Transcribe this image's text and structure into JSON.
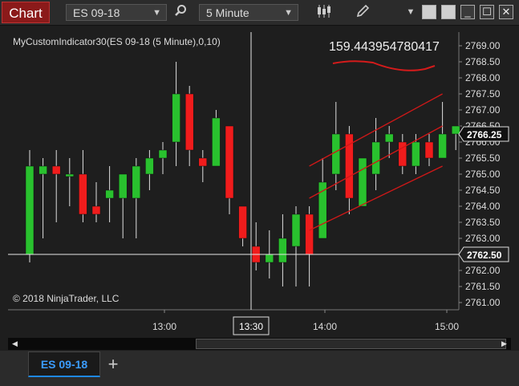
{
  "toolbar": {
    "title": "Chart",
    "instrument": "ES 09-18",
    "interval": "5 Minute"
  },
  "chart": {
    "indicator_label": "MyCustomIndicator30(ES 09-18 (5 Minute),0,10)",
    "big_value": "159.443954780417",
    "copyright": "© 2018 NinjaTrader, LLC",
    "current_price": "2766.25",
    "crosshair_price": "2762.50",
    "crosshair_time": "13:30",
    "colors": {
      "up": "#29c12e",
      "down": "#f01c1c",
      "channel": "#d01818"
    }
  },
  "chart_data": {
    "type": "candlestick",
    "ylim": [
      2760.75,
      2769.25
    ],
    "y_ticks": [
      "2769.00",
      "2768.50",
      "2768.00",
      "2767.50",
      "2767.00",
      "2766.50",
      "2766.00",
      "2765.50",
      "2765.00",
      "2764.50",
      "2764.00",
      "2763.50",
      "2763.00",
      "2762.50",
      "2762.00",
      "2761.50",
      "2761.00"
    ],
    "x_ticks": [
      "13:00",
      "14:00",
      "15:00"
    ],
    "candles": [
      {
        "o": 2762.5,
        "h": 2765.75,
        "l": 2762.25,
        "c": 2765.25
      },
      {
        "o": 2765.0,
        "h": 2765.5,
        "l": 2763.0,
        "c": 2765.25
      },
      {
        "o": 2765.25,
        "h": 2765.75,
        "l": 2763.5,
        "c": 2765.0
      },
      {
        "o": 2765.0,
        "h": 2765.5,
        "l": 2764.0,
        "c": 2765.0
      },
      {
        "o": 2765.0,
        "h": 2765.75,
        "l": 2763.5,
        "c": 2763.75
      },
      {
        "o": 2764.0,
        "h": 2764.75,
        "l": 2763.5,
        "c": 2763.75
      },
      {
        "o": 2764.25,
        "h": 2765.25,
        "l": 2763.5,
        "c": 2764.5
      },
      {
        "o": 2764.25,
        "h": 2765.0,
        "l": 2763.0,
        "c": 2765.0
      },
      {
        "o": 2764.25,
        "h": 2765.5,
        "l": 2763.0,
        "c": 2765.25
      },
      {
        "o": 2765.0,
        "h": 2765.75,
        "l": 2764.5,
        "c": 2765.5
      },
      {
        "o": 2765.5,
        "h": 2766.0,
        "l": 2765.0,
        "c": 2765.75
      },
      {
        "o": 2766.0,
        "h": 2768.5,
        "l": 2765.25,
        "c": 2767.5
      },
      {
        "o": 2767.5,
        "h": 2767.75,
        "l": 2765.25,
        "c": 2765.75
      },
      {
        "o": 2765.5,
        "h": 2765.75,
        "l": 2764.75,
        "c": 2765.25
      },
      {
        "o": 2765.25,
        "h": 2767.0,
        "l": 2765.25,
        "c": 2766.75
      },
      {
        "o": 2766.5,
        "h": 2766.5,
        "l": 2763.75,
        "c": 2764.25
      },
      {
        "o": 2764.0,
        "h": 2764.0,
        "l": 2762.75,
        "c": 2763.0
      },
      {
        "o": 2762.75,
        "h": 2763.5,
        "l": 2762.0,
        "c": 2762.25
      },
      {
        "o": 2762.25,
        "h": 2763.25,
        "l": 2761.75,
        "c": 2762.5
      },
      {
        "o": 2762.25,
        "h": 2763.75,
        "l": 2761.5,
        "c": 2763.0
      },
      {
        "o": 2762.75,
        "h": 2764.0,
        "l": 2761.5,
        "c": 2763.75
      },
      {
        "o": 2763.75,
        "h": 2764.0,
        "l": 2761.5,
        "c": 2762.5
      },
      {
        "o": 2763.0,
        "h": 2765.5,
        "l": 2763.0,
        "c": 2764.75
      },
      {
        "o": 2765.0,
        "h": 2767.25,
        "l": 2764.5,
        "c": 2766.25
      },
      {
        "o": 2766.25,
        "h": 2766.5,
        "l": 2763.75,
        "c": 2764.25
      },
      {
        "o": 2764.0,
        "h": 2765.25,
        "l": 2764.0,
        "c": 2765.5
      },
      {
        "o": 2765.0,
        "h": 2766.75,
        "l": 2764.5,
        "c": 2766.0
      },
      {
        "o": 2766.0,
        "h": 2766.5,
        "l": 2765.5,
        "c": 2766.25
      },
      {
        "o": 2766.0,
        "h": 2766.25,
        "l": 2765.0,
        "c": 2765.25
      },
      {
        "o": 2765.25,
        "h": 2766.25,
        "l": 2765.0,
        "c": 2766.0
      },
      {
        "o": 2766.0,
        "h": 2766.25,
        "l": 2765.25,
        "c": 2765.5
      },
      {
        "o": 2765.5,
        "h": 2767.25,
        "l": 2765.5,
        "c": 2766.25
      },
      {
        "o": 2766.25,
        "h": 2766.5,
        "l": 2765.75,
        "c": 2766.5
      }
    ],
    "channel": {
      "start_index": 21,
      "end_index": 31,
      "upper": [
        2765.25,
        2767.5
      ],
      "middle": [
        2764.25,
        2766.5
      ],
      "lower": [
        2763.25,
        2765.25
      ]
    }
  }
}
